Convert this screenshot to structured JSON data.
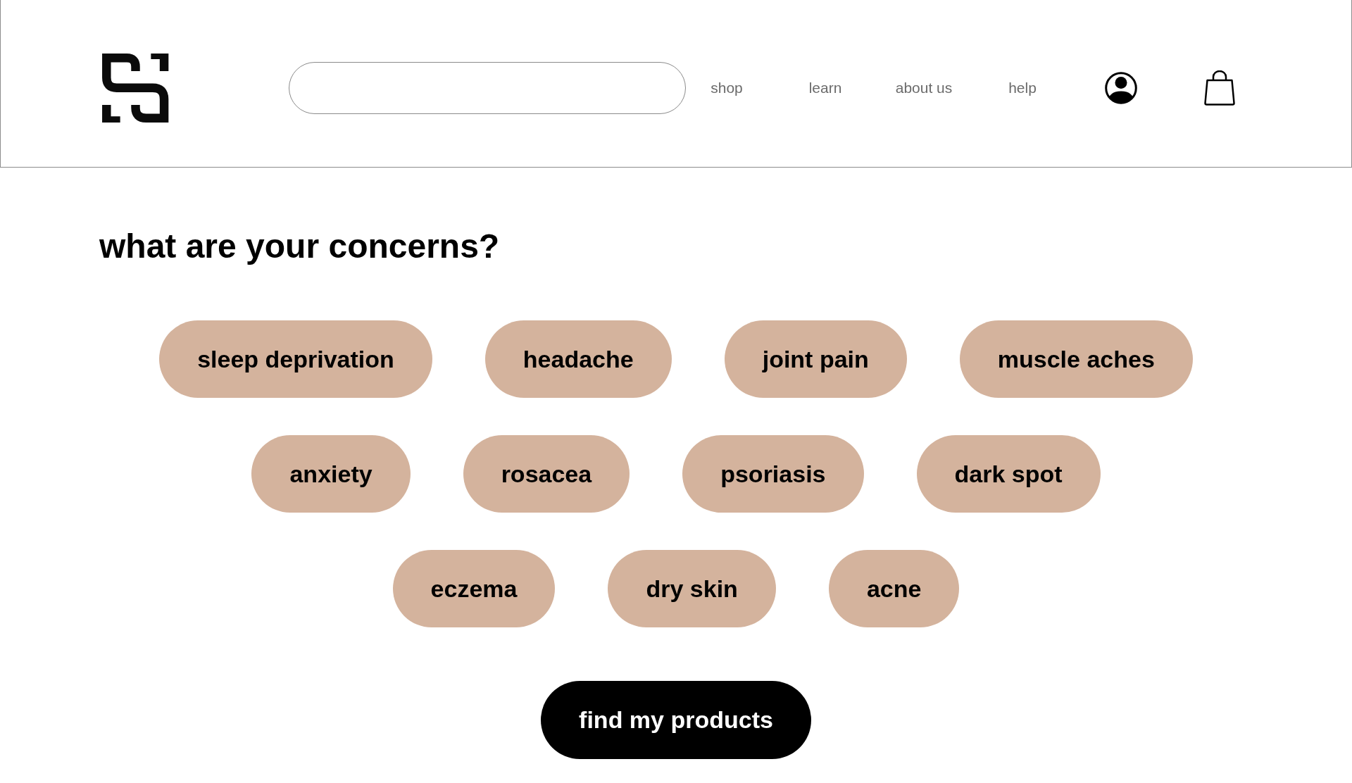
{
  "nav": {
    "links": [
      "shop",
      "learn",
      "about us",
      "help"
    ]
  },
  "heading": "what are your concerns?",
  "concern_rows": [
    {
      "items": [
        {
          "label": "sleep deprivation",
          "selected": false
        },
        {
          "label": "headache",
          "selected": false
        },
        {
          "label": "joint pain",
          "selected": false
        },
        {
          "label": "muscle aches",
          "selected": false
        }
      ]
    },
    {
      "items": [
        {
          "label": "anxiety",
          "selected": false
        },
        {
          "label": "rosacea",
          "selected": false
        },
        {
          "label": "psoriasis",
          "selected": false
        },
        {
          "label": "dark spot",
          "selected": false
        }
      ]
    },
    {
      "items": [
        {
          "label": "eczema",
          "selected": false
        },
        {
          "label": "dry skin",
          "selected": false
        },
        {
          "label": "acne",
          "selected": false
        }
      ]
    }
  ],
  "submit_button": "find my products"
}
